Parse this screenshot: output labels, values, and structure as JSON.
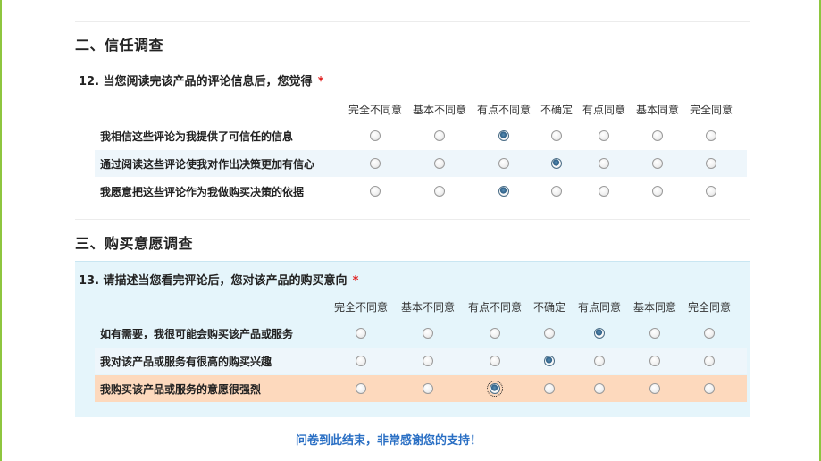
{
  "section2": {
    "title": "二、信任调查",
    "question": {
      "title": "12. 当您阅读完该产品的评论信息后，您觉得",
      "required_mark": "*",
      "options": [
        "完全不同意",
        "基本不同意",
        "有点不同意",
        "不确定",
        "有点同意",
        "基本同意",
        "完全同意"
      ],
      "rows": [
        {
          "label": "我相信这些评论为我提供了可信任的信息",
          "selected": 2
        },
        {
          "label": "通过阅读这些评论使我对作出决策更加有信心",
          "selected": 3
        },
        {
          "label": "我愿意把这些评论作为我做购买决策的依据",
          "selected": 2
        }
      ]
    }
  },
  "section3": {
    "title": "三、购买意愿调查",
    "question": {
      "title": "13. 请描述当您看完评论后，您对该产品的购买意向",
      "required_mark": "*",
      "options": [
        "完全不同意",
        "基本不同意",
        "有点不同意",
        "不确定",
        "有点同意",
        "基本同意",
        "完全同意"
      ],
      "rows": [
        {
          "label": "如有需要，我很可能会购买该产品或服务",
          "selected": 4
        },
        {
          "label": "我对该产品或服务有很高的购买兴趣",
          "selected": 3
        },
        {
          "label": "我购买该产品或服务的意愿很强烈",
          "selected": 2
        }
      ]
    }
  },
  "footer": {
    "text": "问卷到此结束，非常感谢您的支持！"
  },
  "colors": {
    "accent_link": "#2a6fc4",
    "required": "#e02020",
    "question_bg": "#e5f5fb",
    "highlight_row": "#fdd9bd",
    "page_border": "#8ec63f"
  }
}
